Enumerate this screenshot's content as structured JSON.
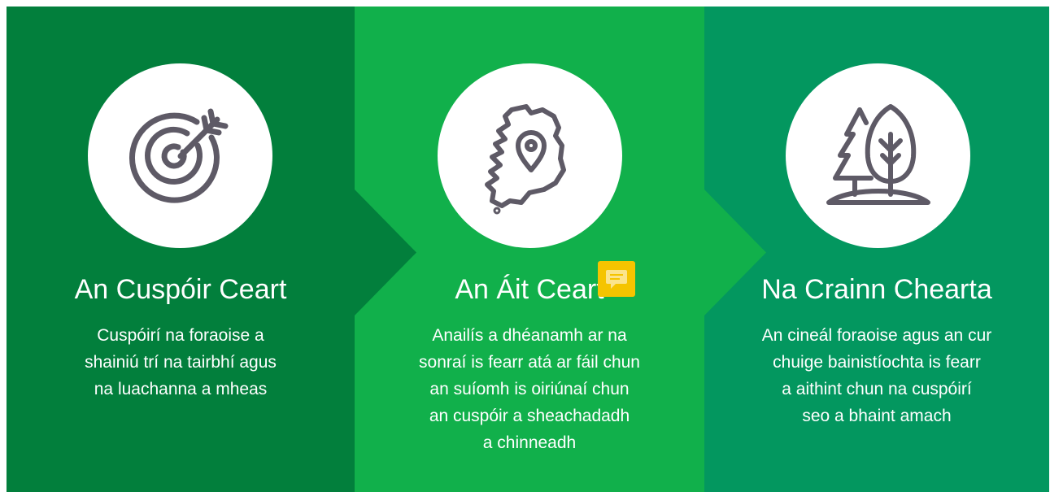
{
  "colors": {
    "panel1": "#027f3c",
    "panel2": "#11b04b",
    "panel3": "#03975f",
    "icon_stroke": "#5e5a66",
    "comment": "#f5c400"
  },
  "panels": [
    {
      "icon": "target-icon",
      "title": "An Cuspóir Ceart",
      "lines": [
        "Cuspóirí na foraoise a",
        "shainiú trí na tairbhí agus",
        "na luachanna a mheas"
      ]
    },
    {
      "icon": "ireland-map-pin-icon",
      "title": "An Áit Ceart",
      "lines": [
        "Anailís a dhéanamh ar na",
        "sonraí is fearr atá ar fáil chun",
        "an suíomh is oiriúnaí chun",
        "an cuspóir a sheachadadh",
        "a chinneadh"
      ]
    },
    {
      "icon": "trees-icon",
      "title": "Na Crainn Chearta",
      "lines": [
        "An cineál foraoise agus an cur",
        "chuige bainistíochta is fearr",
        "a aithint chun na cuspóirí",
        "seo a bhaint amach"
      ]
    }
  ],
  "comment_icon": "comment-icon"
}
